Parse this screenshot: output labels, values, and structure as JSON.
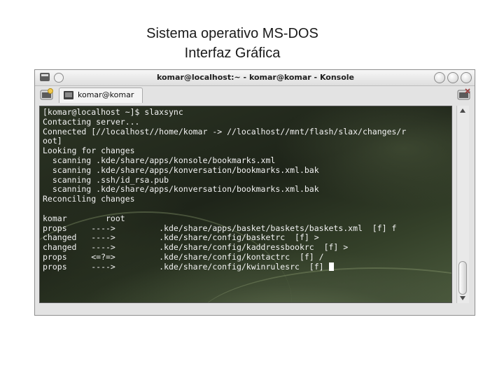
{
  "slide": {
    "title_line1": "Sistema operativo MS-DOS",
    "title_line2": "Interfaz Gráfica"
  },
  "window": {
    "title": "komar@localhost:~ - komar@komar - Konsole",
    "buttons": [
      "menu-icon",
      "sticky-icon",
      "minimize-icon",
      "maximize-icon",
      "close-icon"
    ]
  },
  "tabs": {
    "new_tab_icon": "new-session-icon",
    "close_tab_icon": "close-session-icon",
    "items": [
      {
        "label": "komar@komar",
        "icon": "terminal-icon"
      }
    ]
  },
  "terminal": {
    "lines": [
      "[komar@localhost ~]$ slaxsync",
      "Contacting server...",
      "Connected [//localhost//home/komar -> //localhost//mnt/flash/slax/changes/r",
      "oot]",
      "Looking for changes",
      "  scanning .kde/share/apps/konsole/bookmarks.xml",
      "  scanning .kde/share/apps/konversation/bookmarks.xml.bak",
      "  scanning .ssh/id_rsa.pub",
      "  scanning .kde/share/apps/konversation/bookmarks.xml.bak",
      "Reconciling changes",
      "",
      "komar        root",
      "props     ---->         .kde/share/apps/basket/baskets/baskets.xml  [f] f",
      "changed   ---->         .kde/share/config/basketrc  [f] >",
      "changed   ---->         .kde/share/config/kaddressbookrc  [f] >",
      "props     <=?=>         .kde/share/config/kontactrc  [f] /",
      "props     ---->         .kde/share/config/kwinrulesrc  [f] "
    ]
  },
  "colors": {
    "terminal_text": "#f2f2f2",
    "terminal_background": "#1e2419",
    "window_frame": "#e3e3e3"
  }
}
